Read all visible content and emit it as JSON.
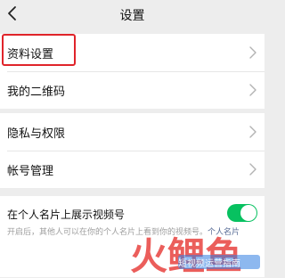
{
  "header": {
    "title": "设置",
    "back_icon": "chevron-left-icon"
  },
  "group_profile": {
    "items": [
      {
        "label": "资料设置"
      },
      {
        "label": "我的二维码"
      }
    ]
  },
  "group_account": {
    "items": [
      {
        "label": "隐私与权限"
      },
      {
        "label": "帐号管理"
      }
    ]
  },
  "video_card_setting": {
    "label": "在个人名片上展示视频号",
    "enabled": true,
    "hint_text": "开启后，其他人可以在你的个人名片上看到你的视频号。",
    "hint_link": "个人名片"
  },
  "watermark": {
    "logo_text": "火鲤鱼",
    "caption": "短视频运营指南"
  },
  "colors": {
    "highlight_border": "#e0242a",
    "toggle_on": "#07c160",
    "link": "#576b95",
    "watermark_red": "#e8423f",
    "watermark_blue": "#2f7de1"
  }
}
